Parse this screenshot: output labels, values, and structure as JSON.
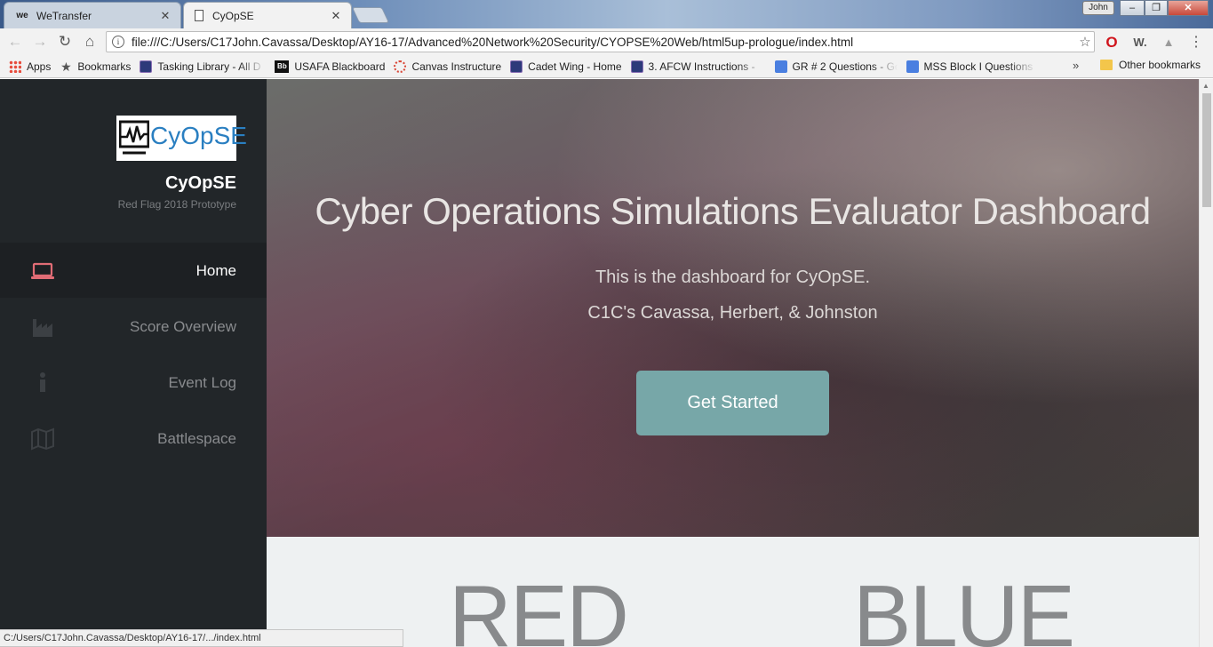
{
  "browser": {
    "tabs": [
      {
        "title": "WeTransfer",
        "icon": "wetransfer-icon",
        "favicon_text": "we"
      },
      {
        "title": "CyOpSE",
        "icon": "document-icon"
      }
    ],
    "profile_name": "John",
    "url": "file:///C:/Users/C17John.Cavassa/Desktop/AY16-17/Advanced%20Network%20Security/CYOPSE%20Web/html5up-prologue/index.html",
    "bookmarks": [
      {
        "label": "Apps",
        "icon": "apps-grid-icon"
      },
      {
        "label": "Bookmarks",
        "icon": "star-icon"
      },
      {
        "label": "Tasking Library - All D",
        "icon": "crest-icon"
      },
      {
        "label": "USAFA Blackboard",
        "icon": "blackboard-icon",
        "icon_text": "Bb"
      },
      {
        "label": "Canvas Instructure",
        "icon": "canvas-icon"
      },
      {
        "label": "Cadet Wing - Home",
        "icon": "crest-icon"
      },
      {
        "label": "3. AFCW Instructions -",
        "icon": "crest-icon"
      },
      {
        "label": "GR # 2 Questions - Go",
        "icon": "google-doc-icon"
      },
      {
        "label": "MSS Block I Questions",
        "icon": "google-doc-icon"
      }
    ],
    "bookmarks_more": "»",
    "other_bookmarks": "Other bookmarks",
    "status_url": "C:/Users/C17John.Cavassa/Desktop/AY16-17/.../index.html"
  },
  "sidebar": {
    "logo_text": "CyOpSE",
    "brand_title": "CyOpSE",
    "brand_subtitle": "Red Flag 2018 Prototype",
    "items": [
      {
        "label": "Home",
        "icon": "laptop-icon",
        "active": true
      },
      {
        "label": "Score Overview",
        "icon": "factory-chart-icon",
        "active": false
      },
      {
        "label": "Event Log",
        "icon": "info-icon",
        "active": false
      },
      {
        "label": "Battlespace",
        "icon": "map-icon",
        "active": false
      }
    ]
  },
  "hero": {
    "title": "Cyber Operations Simulations Evaluator Dashboard",
    "line1": "This is the dashboard for CyOpSE.",
    "line2": "C1C's Cavassa, Herbert, & Johnston",
    "cta_label": "Get Started"
  },
  "teams": {
    "red": "RED",
    "blue": "BLUE"
  },
  "colors": {
    "sidebar_bg": "#222629",
    "active_icon": "#e06c75",
    "cta_bg": "#77a7a8",
    "team_text": "#888a8c"
  }
}
